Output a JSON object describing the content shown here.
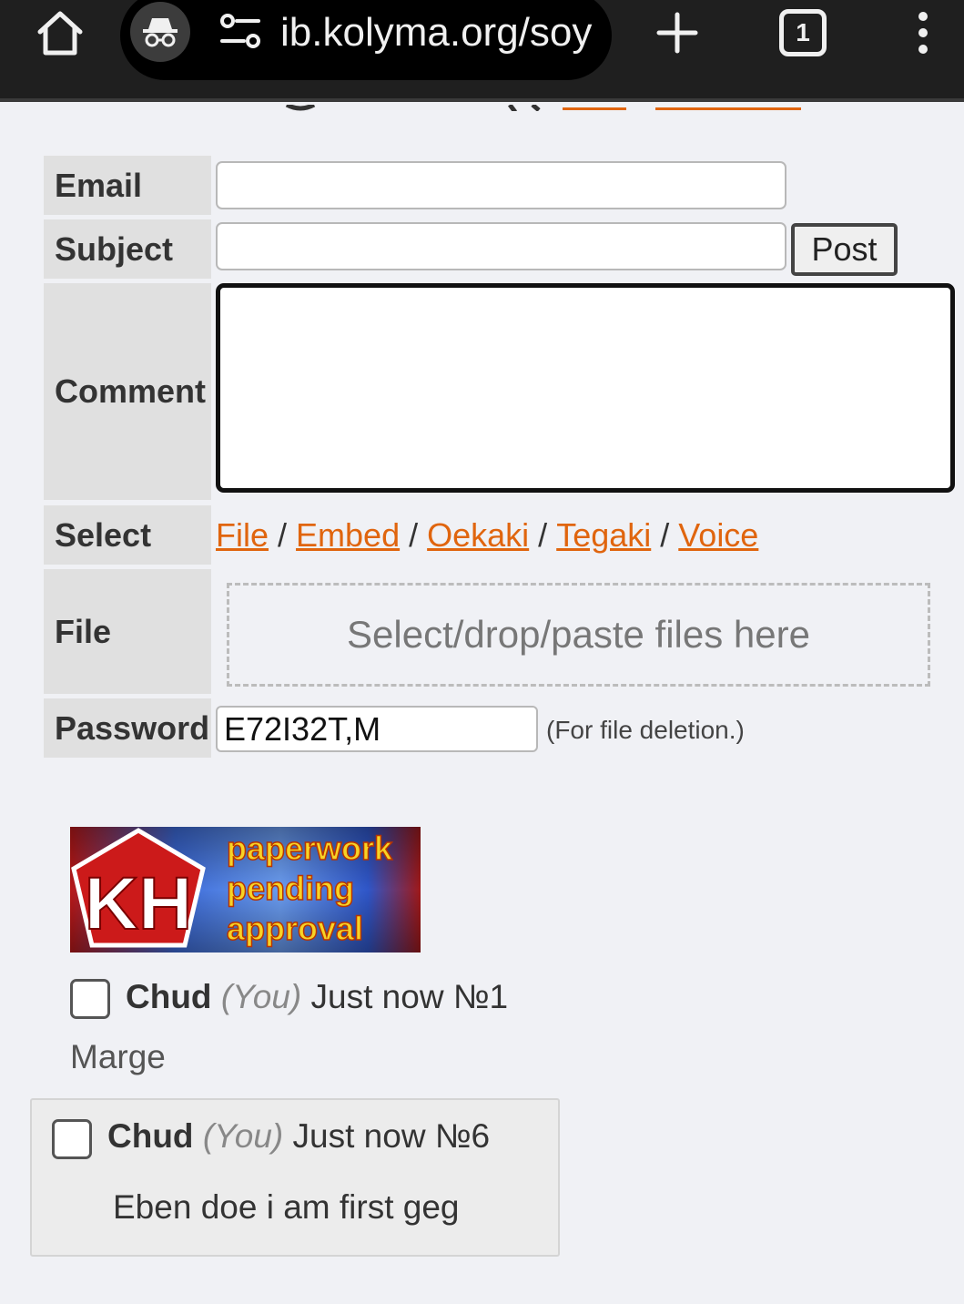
{
  "browser": {
    "url": "ib.kolyma.org/soy",
    "tab_count": "1",
    "icons": [
      "home-icon",
      "incognito-icon",
      "site-settings-icon",
      "new-tab-icon",
      "tab-switcher-icon",
      "more-vert-icon"
    ]
  },
  "form": {
    "email_label": "Email",
    "subject_label": "Subject",
    "post_label": "Post",
    "comment_label": "Comment",
    "select_label": "Select",
    "select_options": [
      "File",
      "Embed",
      "Oekaki",
      "Tegaki",
      "Voice"
    ],
    "select_separator": "/",
    "file_label": "File",
    "dropzone_text": "Select/drop/paste files here",
    "password_label": "Password",
    "password_value": "E72I32T,M",
    "password_note": "(For file deletion.)"
  },
  "banner": {
    "logo_text": "KH",
    "lines": [
      "paperwork",
      "pending",
      "approval"
    ]
  },
  "posts": [
    {
      "name": "Chud",
      "you": "(You)",
      "time": "Just now",
      "number": "№1",
      "body": "Marge"
    },
    {
      "name": "Chud",
      "you": "(You)",
      "time": "Just now",
      "number": "№6",
      "body": "Eben doe i am first geg"
    }
  ],
  "colors": {
    "link": "#e0650e",
    "label_bg": "#e0e0e0",
    "page_bg": "#f0f1f5",
    "toolbar_bg": "#1f1f1f"
  }
}
